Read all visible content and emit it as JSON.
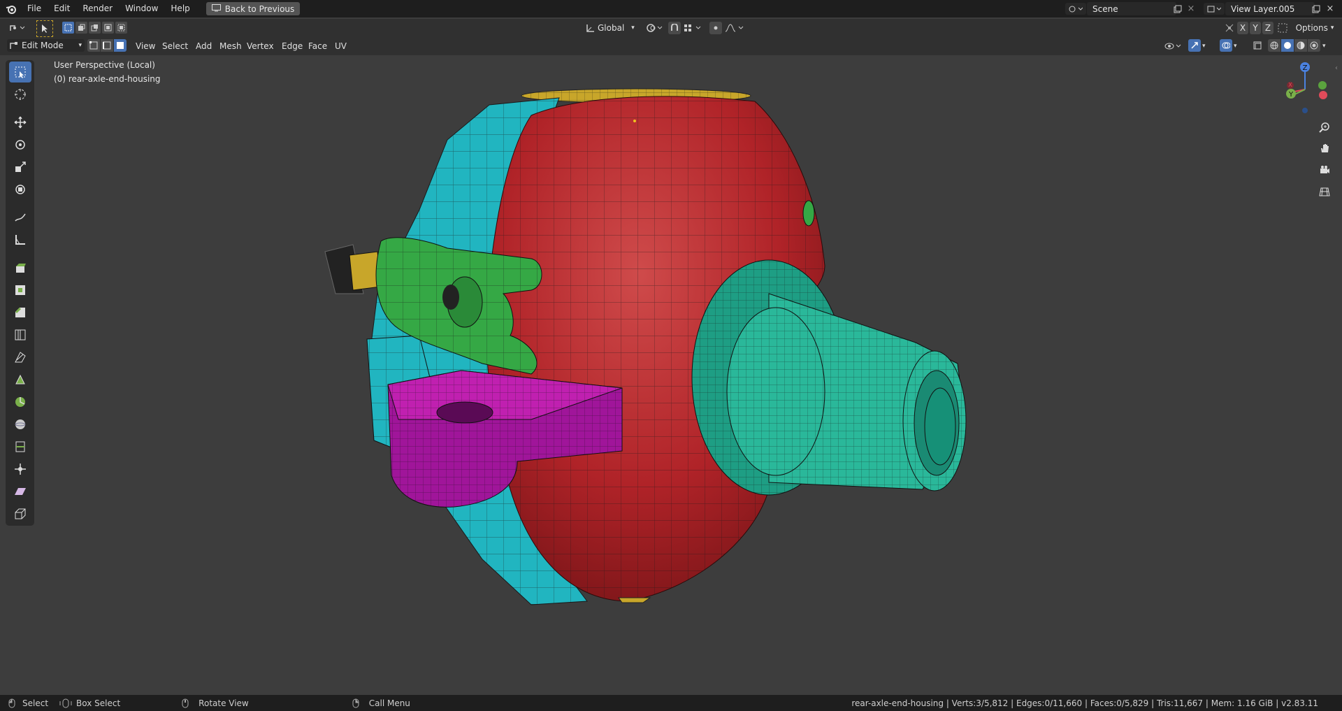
{
  "topbar": {
    "menus": [
      "File",
      "Edit",
      "Render",
      "Window",
      "Help"
    ],
    "back_label": "Back to Previous",
    "scene": "Scene",
    "view_layer": "View Layer.005"
  },
  "header": {
    "transform_orientation": "Global",
    "axes": [
      "X",
      "Y",
      "Z"
    ],
    "options_label": "Options"
  },
  "editor": {
    "mode": "Edit Mode",
    "menus": [
      "View",
      "Select",
      "Add",
      "Mesh",
      "Vertex",
      "Edge",
      "Face",
      "UV"
    ]
  },
  "viewport": {
    "view_name": "User Perspective (Local)",
    "object_label": "(0) rear-axle-end-housing",
    "colors": {
      "housing": "#b8282c",
      "flange": "#2ab89a",
      "bracket": "#c020b0",
      "clamp": "#35a845",
      "plate": "#21b5c0",
      "cap": "#c8a62a"
    }
  },
  "gizmo": {
    "x": "X",
    "y": "Y",
    "z": "Z"
  },
  "toolbar_icons": [
    "select-box-icon",
    "cursor-icon",
    "move-icon",
    "rotate-icon",
    "scale-icon",
    "transform-icon",
    "annotate-icon",
    "measure-icon",
    "extrude-icon",
    "inset-icon",
    "bevel-icon",
    "loop-cut-icon",
    "knife-icon",
    "poly-build-icon",
    "spin-icon",
    "smooth-icon",
    "edge-slide-icon",
    "shrink-fatten-icon",
    "shear-icon",
    "rip-icon"
  ],
  "status": {
    "select": "Select",
    "box_select": "Box Select",
    "rotate": "Rotate View",
    "call_menu": "Call Menu",
    "stats": "rear-axle-end-housing | Verts:3/5,812 | Edges:0/11,660 | Faces:0/5,829 | Tris:11,667 | Mem: 1.16 GiB | v2.83.11"
  }
}
